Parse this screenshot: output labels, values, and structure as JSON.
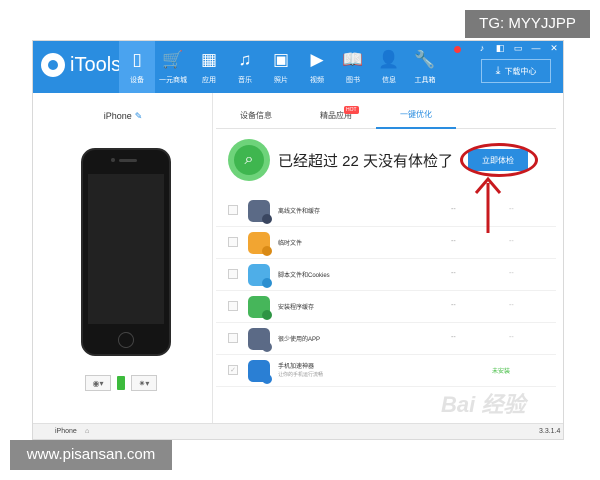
{
  "overlay": {
    "tg": "TG: MYYJJPP",
    "site": "www.pisansan.com"
  },
  "app": {
    "name": "iTools"
  },
  "nav": [
    {
      "label": "设备",
      "icon": "device-icon",
      "glyph": "▯",
      "active": true
    },
    {
      "label": "一元商城",
      "icon": "cart-icon",
      "glyph": "🛒",
      "active": false
    },
    {
      "label": "应用",
      "icon": "apps-icon",
      "glyph": "▦",
      "active": false
    },
    {
      "label": "音乐",
      "icon": "music-icon",
      "glyph": "♫",
      "active": false
    },
    {
      "label": "照片",
      "icon": "photo-icon",
      "glyph": "▣",
      "active": false
    },
    {
      "label": "视频",
      "icon": "video-icon",
      "glyph": "▶",
      "active": false
    },
    {
      "label": "图书",
      "icon": "book-icon",
      "glyph": "📖",
      "active": false
    },
    {
      "label": "信息",
      "icon": "contacts-icon",
      "glyph": "👤",
      "active": false
    },
    {
      "label": "工具箱",
      "icon": "toolbox-icon",
      "glyph": "🔧",
      "active": false
    }
  ],
  "window_controls": [
    "♪",
    "◧",
    "▭",
    "—",
    "✕"
  ],
  "download_btn": {
    "label": "下载中心"
  },
  "device": {
    "name": "iPhone"
  },
  "tabs": [
    {
      "label": "设备信息",
      "active": false
    },
    {
      "label": "精品应用",
      "active": false
    },
    {
      "label": "一键优化",
      "active": true
    }
  ],
  "hot_badge": "HOT",
  "banner": {
    "text": "已经超过 22 天没有体检了",
    "button": "立即体检"
  },
  "rows": [
    {
      "title": "离线文件和缓存",
      "sub": "",
      "m1": "--",
      "m2": "--",
      "status": "",
      "icon_color": "#5b6a86",
      "badge_color": "#3a4660",
      "checked": false
    },
    {
      "title": "临时文件",
      "sub": "",
      "m1": "--",
      "m2": "--",
      "status": "",
      "icon_color": "#f2a531",
      "badge_color": "#d98a16",
      "checked": false
    },
    {
      "title": "脚本文件和Cookies",
      "sub": "",
      "m1": "--",
      "m2": "--",
      "status": "",
      "icon_color": "#4eaee8",
      "badge_color": "#2b8fd0",
      "checked": false
    },
    {
      "title": "安装程序缓存",
      "sub": "",
      "m1": "--",
      "m2": "--",
      "status": "",
      "icon_color": "#46b65a",
      "badge_color": "#2d9443",
      "checked": false
    },
    {
      "title": "很少使用的APP",
      "sub": "",
      "m1": "--",
      "m2": "--",
      "status": "",
      "icon_color": "#5b6a86",
      "badge_color": "#5b6a86",
      "checked": false
    },
    {
      "title": "手机加速神器",
      "sub": "让你的手机运行流畅",
      "m1": "",
      "m2": "",
      "status": "未安装",
      "icon_color": "#2a7fd4",
      "badge_color": "#2a7fd4",
      "checked": true
    }
  ],
  "statusbar": {
    "device": "iPhone",
    "version": "3.3.1.4"
  },
  "watermark": "Bai 经验"
}
